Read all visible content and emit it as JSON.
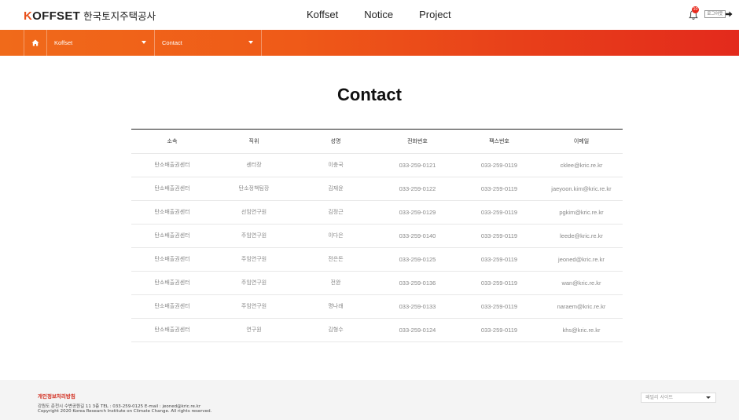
{
  "header": {
    "logo_en_first": "K",
    "logo_en_rest": "OFFSET",
    "logo_ko": "한국토지주택공사",
    "nav": [
      "Koffset",
      "Notice",
      "Project"
    ],
    "notification_count": "10",
    "login_label": "로그아웃",
    "icons": {
      "bell": "bell-icon",
      "login_arrow": "arrow-right-icon",
      "home": "home-icon"
    }
  },
  "breadcrumb": {
    "level1": "Koffset",
    "level2": "Contact"
  },
  "page": {
    "title": "Contact"
  },
  "table": {
    "columns": [
      "소속",
      "직위",
      "성명",
      "전화번호",
      "팩스번호",
      "이메일"
    ],
    "rows": [
      [
        "탄소배출권센터",
        "센터장",
        "이충국",
        "033-259-0121",
        "033-259-0119",
        "cklee@kric.re.kr"
      ],
      [
        "탄소배출권센터",
        "탄소정책팀장",
        "김재윤",
        "033-259-0122",
        "033-259-0119",
        "jaeyoon.kim@kric.re.kr"
      ],
      [
        "탄소배출권센터",
        "선임연구원",
        "김정근",
        "033-259-0129",
        "033-259-0119",
        "pgkim@kric.re.kr"
      ],
      [
        "탄소배출권센터",
        "주임연구원",
        "이다은",
        "033-259-0140",
        "033-259-0119",
        "leede@kric.re.kr"
      ],
      [
        "탄소배출권센터",
        "주임연구원",
        "전은돈",
        "033-259-0125",
        "033-259-0119",
        "jeoned@kric.re.kr"
      ],
      [
        "탄소배출권센터",
        "주임연구원",
        "전완",
        "033-259-0136",
        "033-259-0119",
        "wan@kric.re.kr"
      ],
      [
        "탄소배출권센터",
        "주임연구원",
        "명나래",
        "033-259-0133",
        "033-259-0119",
        "naraem@kric.re.kr"
      ],
      [
        "탄소배출권센터",
        "연구원",
        "김형수",
        "033-259-0124",
        "033-259-0119",
        "khs@kric.re.kr"
      ]
    ]
  },
  "footer": {
    "privacy_title": "개인정보처리방침",
    "address_line": "강원도 춘천시 수변공원길 11 3층    TEL : 033-259-0125    E-mail : jeoned@kric.re.kr",
    "copyright": "Copyright 2020 Korea Research Institute on Climate Change. All rights reserved.",
    "family_site_label": "패밀리 사이트"
  },
  "colors": {
    "accent": "#ef5a18",
    "accent_end": "#e32a1c",
    "badge": "#e8291c",
    "privacy_red": "#d22b1c"
  }
}
